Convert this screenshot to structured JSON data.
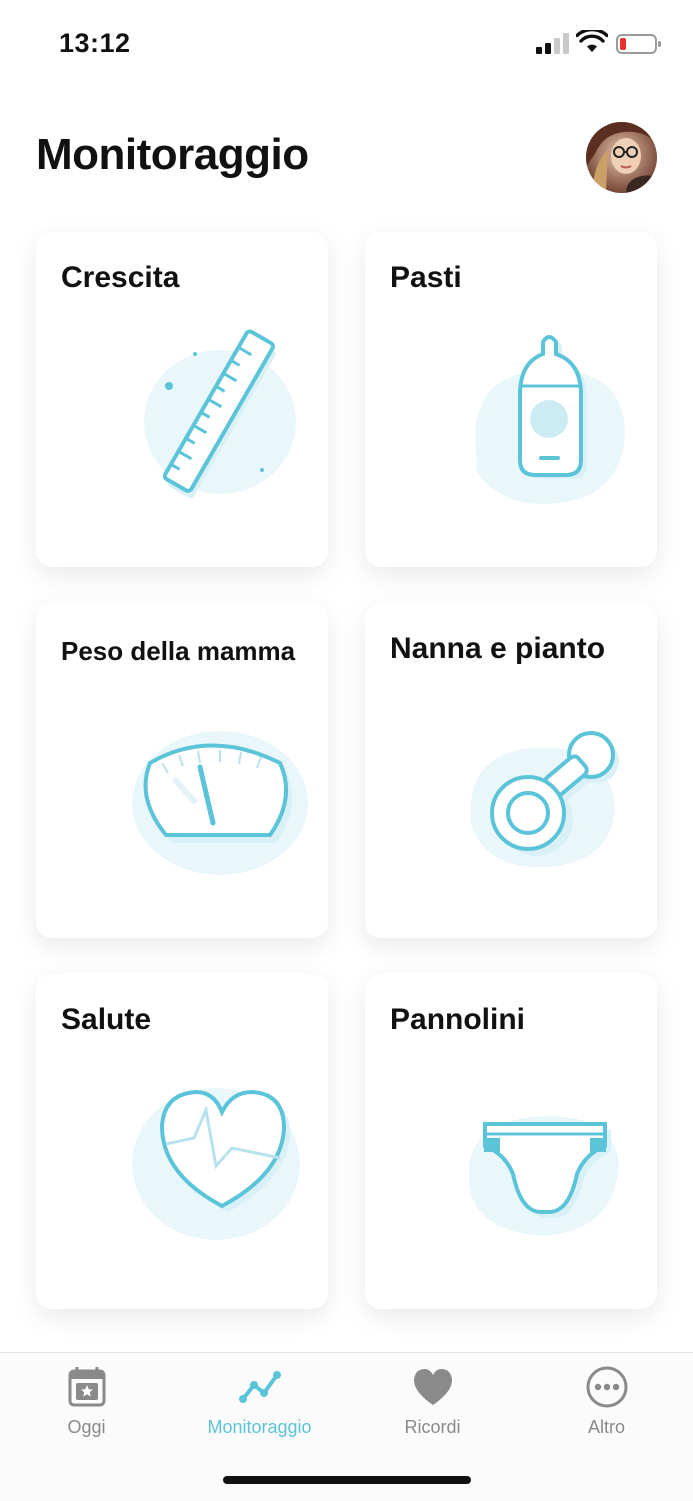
{
  "status_bar": {
    "time": "13:12",
    "signal_icon": "cellular-signal-icon",
    "wifi_icon": "wifi-icon",
    "battery_icon": "battery-low-icon",
    "battery_color": "#e5322d"
  },
  "header": {
    "title": "Monitoraggio",
    "avatar_icon": "user-avatar"
  },
  "accent_color": "#5bc4d9",
  "cards": [
    {
      "label": "Crescita",
      "icon": "ruler-icon"
    },
    {
      "label": "Pasti",
      "icon": "baby-bottle-icon"
    },
    {
      "label": "Peso della mamma",
      "icon": "scale-icon"
    },
    {
      "label": "Nanna e pianto",
      "icon": "pacifier-icon"
    },
    {
      "label": "Salute",
      "icon": "heart-pulse-icon"
    },
    {
      "label": "Pannolini",
      "icon": "diaper-icon"
    }
  ],
  "tab_bar": {
    "tabs": [
      {
        "label": "Oggi",
        "icon": "calendar-star-icon",
        "active": false
      },
      {
        "label": "Monitoraggio",
        "icon": "trend-chart-icon",
        "active": true
      },
      {
        "label": "Ricordi",
        "icon": "heart-icon",
        "active": false
      },
      {
        "label": "Altro",
        "icon": "more-circle-icon",
        "active": false
      }
    ]
  }
}
